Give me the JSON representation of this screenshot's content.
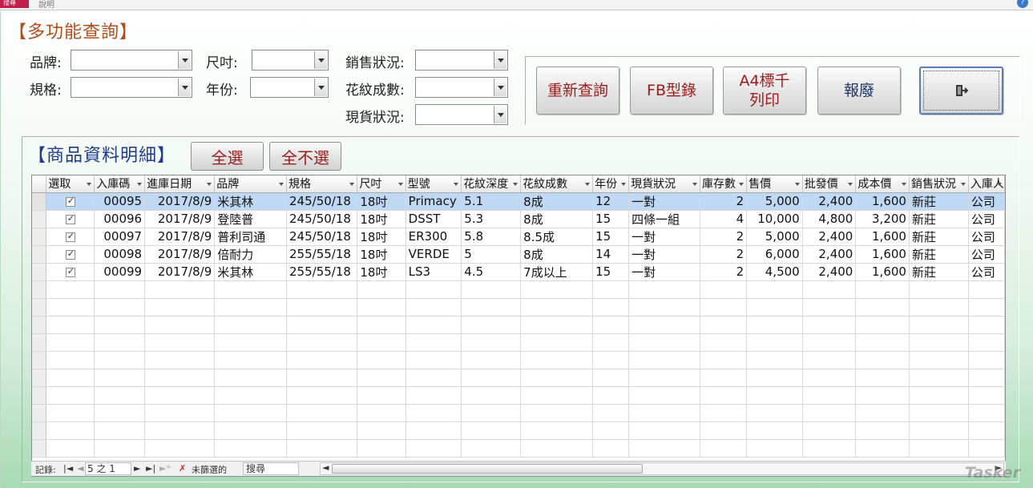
{
  "topbar": {
    "left_tab": "搜尋",
    "right_tab": "說明"
  },
  "form_title": "【多功能查詢】",
  "filters": {
    "brand": {
      "label": "品牌:",
      "value": ""
    },
    "size": {
      "label": "尺吋:",
      "value": ""
    },
    "sales_status": {
      "label": "銷售狀況:",
      "value": ""
    },
    "spec": {
      "label": "規格:",
      "value": ""
    },
    "year": {
      "label": "年份:",
      "value": ""
    },
    "tread_grade": {
      "label": "花紋成數:",
      "value": ""
    },
    "stock_status": {
      "label": "現貨狀況:",
      "value": ""
    }
  },
  "actions": {
    "requery": "重新查詢",
    "fb_catalog": "FB型錄",
    "a4_print_line1": "A4標千",
    "a4_print_line2": "列印",
    "scrap": "報廢"
  },
  "details": {
    "title": "【商品資料明細】",
    "select_all": "全選",
    "select_none": "全不選"
  },
  "grid": {
    "columns": [
      "選取",
      "入庫碼",
      "進庫日期",
      "品牌",
      "規格",
      "尺吋",
      "型號",
      "花紋深度",
      "花紋成數",
      "年份",
      "現貨狀況",
      "庫存數",
      "售價",
      "批發價",
      "成本價",
      "銷售狀況",
      "入庫人"
    ],
    "rows": [
      {
        "id": "00095",
        "date": "2017/8/9",
        "brand": "米其林",
        "spec": "245/50/18",
        "size": "18吋",
        "model": "Primacy",
        "depth": "5.1",
        "grade": "8成",
        "year": "12",
        "stock": "一對",
        "qty": "2",
        "price": "5,000",
        "wholesale": "2,400",
        "cost": "1,600",
        "status": "新莊",
        "person": "公司"
      },
      {
        "id": "00096",
        "date": "2017/8/9",
        "brand": "登陸普",
        "spec": "245/50/18",
        "size": "18吋",
        "model": "DSST",
        "depth": "5.3",
        "grade": "8成",
        "year": "15",
        "stock": "四條一組",
        "qty": "4",
        "price": "10,000",
        "wholesale": "4,800",
        "cost": "3,200",
        "status": "新莊",
        "person": "公司"
      },
      {
        "id": "00097",
        "date": "2017/8/9",
        "brand": "普利司通",
        "spec": "245/50/18",
        "size": "18吋",
        "model": "ER300",
        "depth": "5.8",
        "grade": "8.5成",
        "year": "15",
        "stock": "一對",
        "qty": "2",
        "price": "5,000",
        "wholesale": "2,400",
        "cost": "1,600",
        "status": "新莊",
        "person": "公司"
      },
      {
        "id": "00098",
        "date": "2017/8/9",
        "brand": "倍耐力",
        "spec": "255/55/18",
        "size": "18吋",
        "model": "VERDE",
        "depth": "5",
        "grade": "8成",
        "year": "14",
        "stock": "一對",
        "qty": "2",
        "price": "6,000",
        "wholesale": "2,400",
        "cost": "1,600",
        "status": "新莊",
        "person": "公司"
      },
      {
        "id": "00099",
        "date": "2017/8/9",
        "brand": "米其林",
        "spec": "255/55/18",
        "size": "18吋",
        "model": "LS3",
        "depth": "4.5",
        "grade": "7成以上",
        "year": "15",
        "stock": "一對",
        "qty": "2",
        "price": "4,500",
        "wholesale": "2,400",
        "cost": "1,600",
        "status": "新莊",
        "person": "公司"
      }
    ]
  },
  "navigation": {
    "record_label": "記錄:",
    "record_position": "5 之 1",
    "filter_status": "未篩選的",
    "search_placeholder": "搜尋"
  },
  "watermark": "Tasker",
  "colors": {
    "title": "#b24d1c",
    "subtitle": "#1f3b8c",
    "button_text": "#9b1c1c",
    "current_row": "#bfd9f4"
  }
}
